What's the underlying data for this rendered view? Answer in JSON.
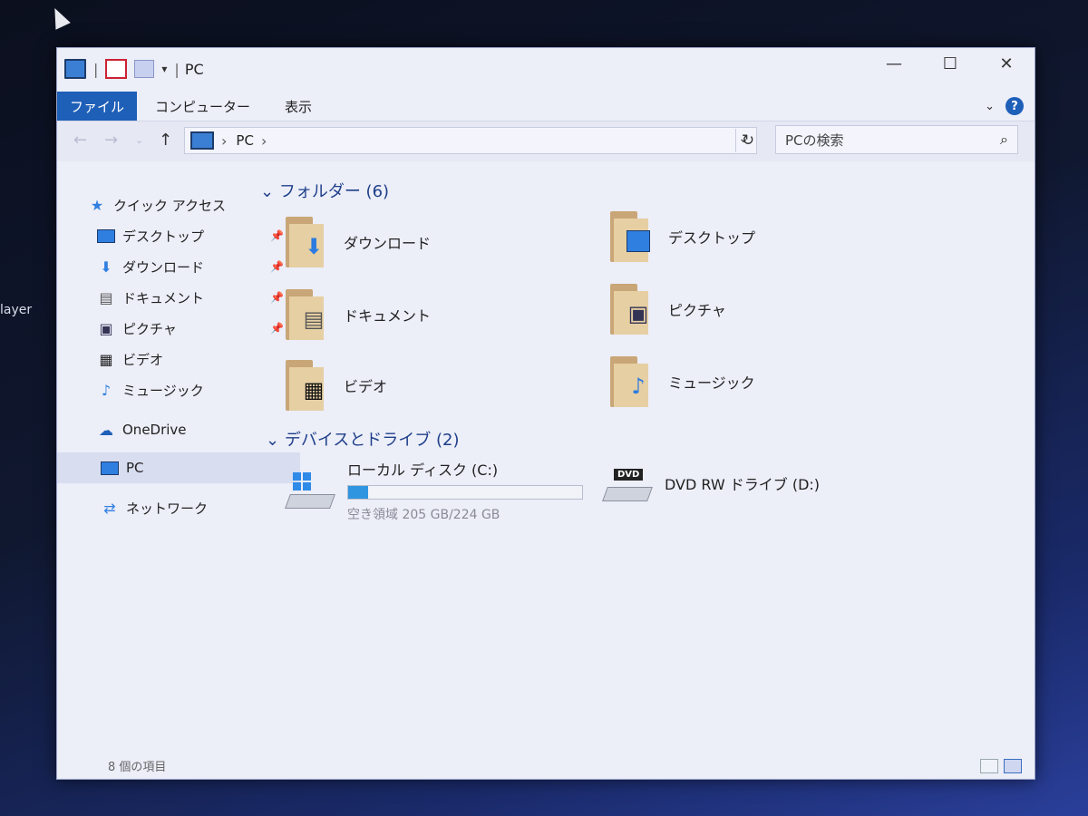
{
  "desktop": {
    "partial_label": "layer"
  },
  "window": {
    "title": "PC",
    "controls": {
      "minimize": "—",
      "maximize": "☐",
      "close": "✕"
    },
    "ribbon_tabs": [
      "ファイル",
      "コンピューター",
      "表示"
    ],
    "address": {
      "path_text": "PC"
    },
    "search": {
      "placeholder": "PCの検索"
    },
    "nav": {
      "quick_access": "クイック アクセス",
      "items": [
        {
          "label": "デスクトップ",
          "pinned": true
        },
        {
          "label": "ダウンロード",
          "pinned": true
        },
        {
          "label": "ドキュメント",
          "pinned": true
        },
        {
          "label": "ピクチャ",
          "pinned": true
        },
        {
          "label": "ビデオ",
          "pinned": false
        },
        {
          "label": "ミュージック",
          "pinned": false
        }
      ],
      "onedrive": "OneDrive",
      "pc": "PC",
      "network": "ネットワーク"
    },
    "folders": {
      "heading": "フォルダー (6)",
      "items": [
        "ダウンロード",
        "デスクトップ",
        "ドキュメント",
        "ピクチャ",
        "ビデオ",
        "ミュージック"
      ]
    },
    "devices": {
      "heading": "デバイスとドライブ (2)",
      "local": {
        "name": "ローカル ディスク (C:)",
        "free_text": "空き領域 205 GB/224 GB",
        "used_fraction": 0.085
      },
      "dvd": {
        "name": "DVD RW ドライブ (D:)",
        "badge": "DVD"
      }
    },
    "status": {
      "item_count": "8 個の項目"
    }
  }
}
